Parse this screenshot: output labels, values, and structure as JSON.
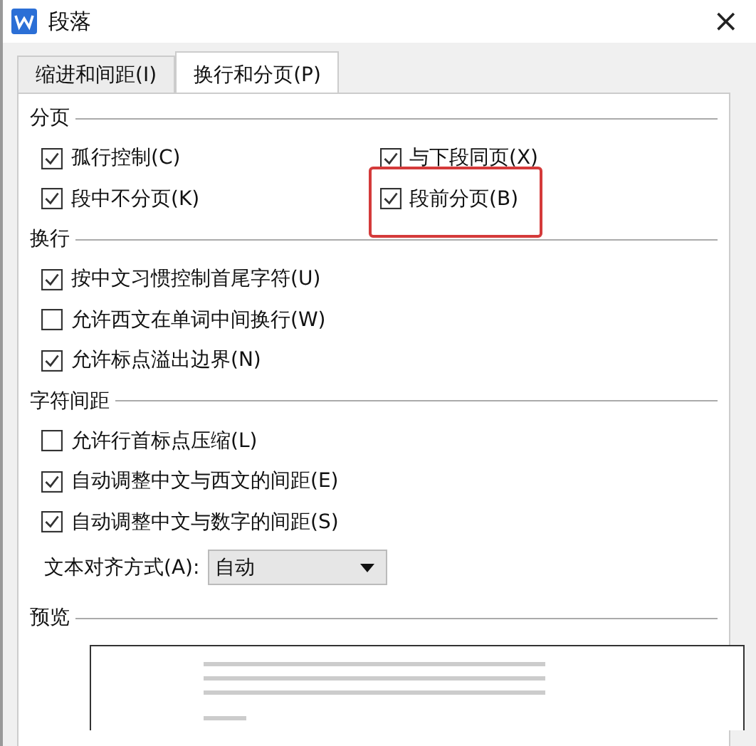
{
  "window": {
    "title": "段落",
    "close": "×"
  },
  "tabs": [
    {
      "label": "缩进和间距(I)",
      "selected": false
    },
    {
      "label": "换行和分页(P)",
      "selected": true
    }
  ],
  "sections": [
    {
      "title": "分页",
      "kind": "two-column",
      "options": [
        {
          "label": "孤行控制(C)",
          "checked": true,
          "highlighted": false
        },
        {
          "label": "与下段同页(X)",
          "checked": true,
          "highlighted": false
        },
        {
          "label": "段中不分页(K)",
          "checked": true,
          "highlighted": false
        },
        {
          "label": "段前分页(B)",
          "checked": true,
          "highlighted": true
        }
      ]
    },
    {
      "title": "换行",
      "kind": "one-column",
      "options": [
        {
          "label": "按中文习惯控制首尾字符(U)",
          "checked": true,
          "highlighted": false
        },
        {
          "label": "允许西文在单词中间换行(W)",
          "checked": false,
          "highlighted": false
        },
        {
          "label": "允许标点溢出边界(N)",
          "checked": true,
          "highlighted": false
        }
      ]
    },
    {
      "title": "字符间距",
      "kind": "one-column",
      "options": [
        {
          "label": "允许行首标点压缩(L)",
          "checked": false,
          "highlighted": false
        },
        {
          "label": "自动调整中文与西文的间距(E)",
          "checked": true,
          "highlighted": false
        },
        {
          "label": "自动调整中文与数字的间距(S)",
          "checked": true,
          "highlighted": false
        }
      ]
    }
  ],
  "alignment": {
    "label": "文本对齐方式(A):",
    "value": "自动"
  },
  "preview": {
    "title": "预览"
  }
}
